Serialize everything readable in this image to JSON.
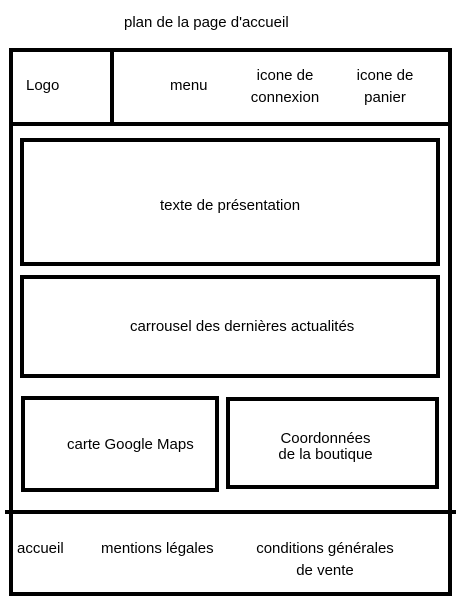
{
  "title": "plan de la  page d'accueil",
  "header": {
    "logo": "Logo",
    "menu": "menu",
    "login_icon": [
      "icone de",
      "connexion"
    ],
    "cart_icon": [
      "icone de",
      "panier"
    ]
  },
  "main": {
    "presentation": "texte de présentation",
    "carousel": "carrousel des dernières actualités",
    "map": "carte Google Maps",
    "shop_contact": [
      "Coordonnées",
      "de la boutique"
    ]
  },
  "footer": {
    "home": "accueil",
    "legal": "mentions légales",
    "terms": [
      "conditions générales",
      "de vente"
    ]
  }
}
